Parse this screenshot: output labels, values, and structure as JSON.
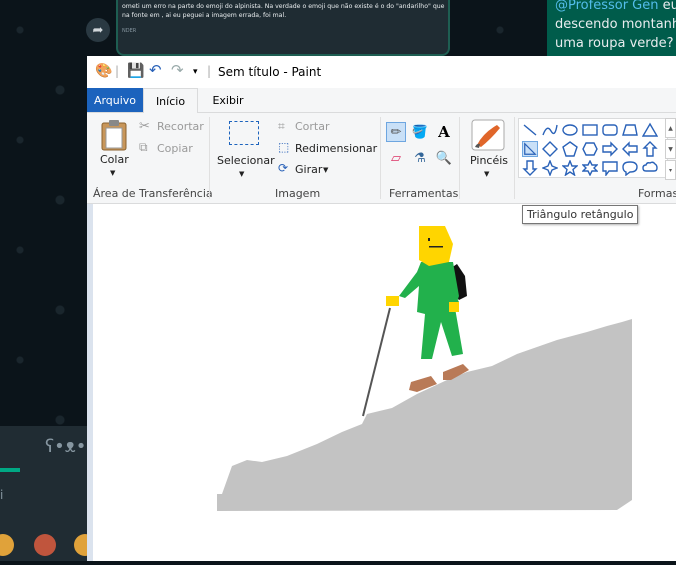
{
  "chat": {
    "dark_message": {
      "text": "ometi um erro na parte do emoji do alpinista. Na verdade o emoji que não existe é o do \"andarilho\" que na fonte em , ai eu peguei a imagem errada, foi mal.",
      "sender_tag": "NDER"
    },
    "green_message": {
      "mention": "@Professor Gen",
      "line1_rest": " eu",
      "line2": "descendo montanha",
      "line3": "uma roupa verde?"
    },
    "search_placeholder": "i"
  },
  "paint": {
    "title": "Sem título - Paint",
    "tabs": {
      "file": "Arquivo",
      "home": "Início",
      "view": "Exibir"
    },
    "clipboard": {
      "paste": "Colar",
      "cut": "Recortar",
      "copy": "Copiar",
      "group": "Área de Transferência"
    },
    "image": {
      "select": "Selecionar",
      "crop": "Cortar",
      "resize": "Redimensionar",
      "rotate": "Girar",
      "group": "Imagem"
    },
    "tools": {
      "group": "Ferramentas"
    },
    "brushes": {
      "label": "Pincéis"
    },
    "shapes": {
      "group": "Formas"
    },
    "tooltip": "Triângulo retângulo"
  },
  "colors": {
    "paint_accent": "#1c63bd",
    "chat_green": "#005c4b",
    "climber_green": "#22b14c",
    "snow_gray": "#c3c3c3"
  }
}
